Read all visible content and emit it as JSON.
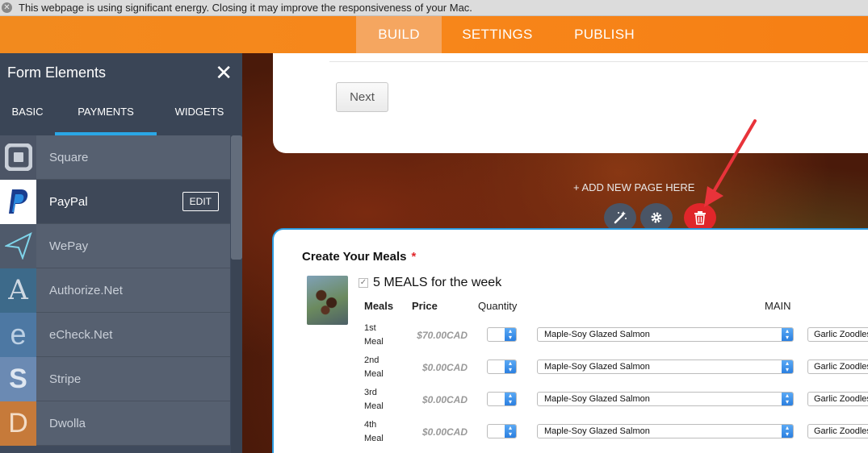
{
  "energy_banner": {
    "message": "This webpage is using significant energy. Closing it may improve the responsiveness of your Mac."
  },
  "top_nav": {
    "tabs": [
      {
        "label": "BUILD"
      },
      {
        "label": "SETTINGS"
      },
      {
        "label": "PUBLISH"
      }
    ],
    "active": "BUILD"
  },
  "sidebar": {
    "title": "Form Elements",
    "tabs": [
      {
        "label": "BASIC"
      },
      {
        "label": "PAYMENTS"
      },
      {
        "label": "WIDGETS"
      }
    ],
    "active_tab": "PAYMENTS",
    "items": [
      {
        "label": "Square",
        "icon": "square-icon",
        "color": "#4c5566"
      },
      {
        "label": "PayPal",
        "icon": "paypal-icon",
        "color": "#ffffff",
        "edit_label": "EDIT"
      },
      {
        "label": "WePay",
        "icon": "wepay-icon",
        "color": "#4f5a6b"
      },
      {
        "label": "Authorize.Net",
        "icon": "authorize-net-icon",
        "color": "#3d6a8a",
        "glyph": "A"
      },
      {
        "label": "eCheck.Net",
        "icon": "echeck-icon",
        "color": "#4d78a3",
        "glyph": "e"
      },
      {
        "label": "Stripe",
        "icon": "stripe-icon",
        "color": "#6b8ab3",
        "glyph": "S"
      },
      {
        "label": "Dwolla",
        "icon": "dwolla-icon",
        "color": "#c67a3a",
        "glyph": "D"
      }
    ]
  },
  "page": {
    "next_label": "Next",
    "add_page_label": "+ ADD NEW PAGE HERE"
  },
  "toolbar": {
    "icons": [
      "magic-wand-icon",
      "gear-icon",
      "trash-icon"
    ],
    "delete_color": "#e0262a"
  },
  "form": {
    "label": "Create Your Meals",
    "required_mark": "*",
    "product_title": "5 MEALS for the week",
    "headers": {
      "meals": "Meals",
      "price": "Price",
      "quantity": "Quantity",
      "main": "MAIN"
    },
    "rows": [
      {
        "line1": "1st",
        "line2": "Meal",
        "price": "$70.00CAD",
        "main": "Maple-Soy Glazed Salmon",
        "side": "Garlic Zoodles"
      },
      {
        "line1": "2nd",
        "line2": "Meal",
        "price": "$0.00CAD",
        "main": "Maple-Soy Glazed Salmon",
        "side": "Garlic Zoodles"
      },
      {
        "line1": "3rd",
        "line2": "Meal",
        "price": "$0.00CAD",
        "main": "Maple-Soy Glazed Salmon",
        "side": "Garlic Zoodles"
      },
      {
        "line1": "4th",
        "line2": "Meal",
        "price": "$0.00CAD",
        "main": "Maple-Soy Glazed Salmon",
        "side": "Garlic Zoodles"
      }
    ]
  },
  "accent_colors": {
    "nav_orange": "#f7861a",
    "tab_underline": "#2aa7e6",
    "focus_border": "#2b9be0",
    "annotation_arrow": "#e8333a"
  }
}
